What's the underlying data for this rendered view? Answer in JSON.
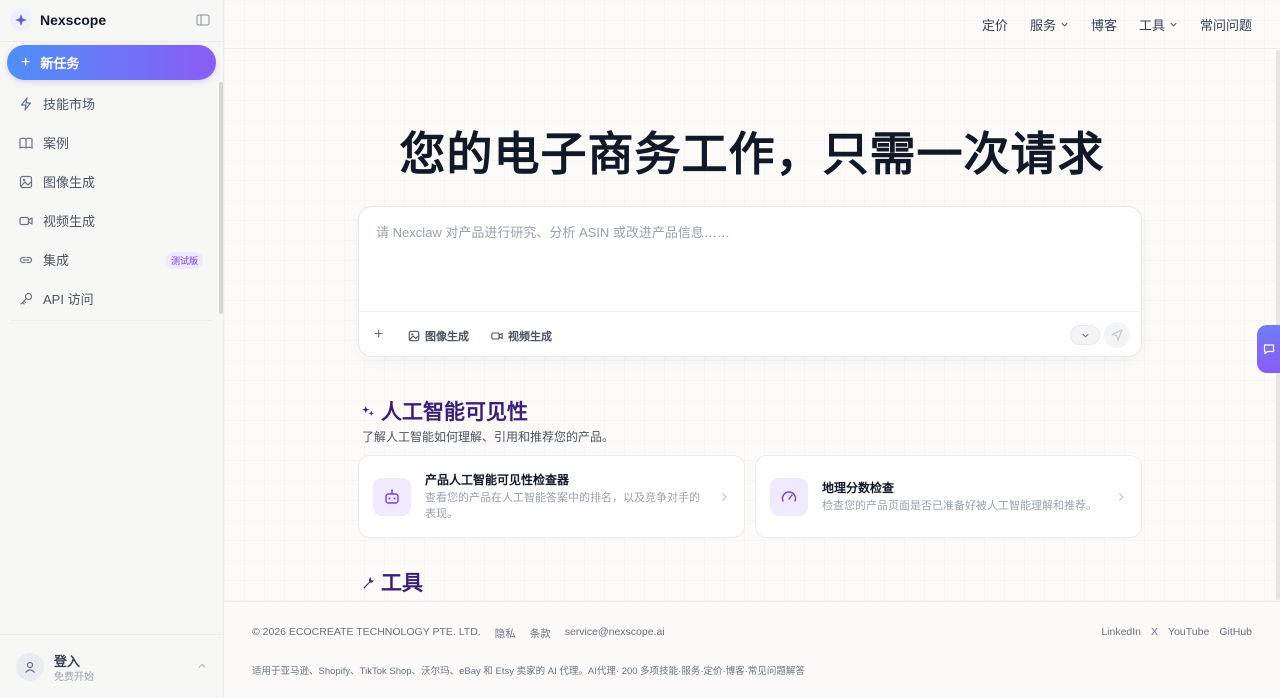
{
  "brand": {
    "name": "Nexscope"
  },
  "sidebar": {
    "new_task_label": "新任务",
    "items": [
      {
        "label": "技能市场",
        "icon": "lightning-icon"
      },
      {
        "label": "案例",
        "icon": "book-icon"
      },
      {
        "label": "图像生成",
        "icon": "image-icon"
      },
      {
        "label": "视频生成",
        "icon": "video-icon"
      },
      {
        "label": "集成",
        "icon": "link-icon",
        "badge": "测试版"
      },
      {
        "label": "API 访问",
        "icon": "key-icon"
      }
    ],
    "login": {
      "title": "登入",
      "subtitle": "免费开始"
    }
  },
  "topnav": {
    "pricing": "定价",
    "services": "服务",
    "blog": "博客",
    "tools": "工具",
    "faq": "常问问题"
  },
  "hero": {
    "title": "您的电子商务工作，只需一次请求"
  },
  "prompt": {
    "placeholder": "请 Nexclaw 对产品进行研究、分析 ASIN 或改进产品信息……",
    "value": "",
    "image_tool": "图像生成",
    "video_tool": "视频生成"
  },
  "section_visibility": {
    "title": "人工智能可见性",
    "description": "了解人工智能如何理解、引用和推荐您的产品。",
    "cards": [
      {
        "title": "产品人工智能可见性检查器",
        "description": "查看您的产品在人工智能答案中的排名，以及竞争对手的表现。",
        "icon": "robot-icon"
      },
      {
        "title": "地理分数检查",
        "description": "检查您的产品页面是否已准备好被人工智能理解和推荐。",
        "icon": "gauge-icon"
      }
    ]
  },
  "section_tools": {
    "title": "工具"
  },
  "footer": {
    "copyright": "© 2026 ECOCREATE TECHNOLOGY PTE. LTD.",
    "privacy": "隐私",
    "terms": "条款",
    "email": "service@nexscope.ai",
    "social": [
      "LinkedIn",
      "X",
      "YouTube",
      "GitHub"
    ],
    "description": "适用于亚马逊、Shopify、TikTok Shop、沃尔玛、eBay 和 Etsy 卖家的 AI 代理。AI代理· 200 多项技能·服务·定价·博客·常见问题解答"
  },
  "colors": {
    "accent_start": "#4f8ff7",
    "accent_end": "#8b5cf6",
    "section_title": "#3b1e7a"
  }
}
